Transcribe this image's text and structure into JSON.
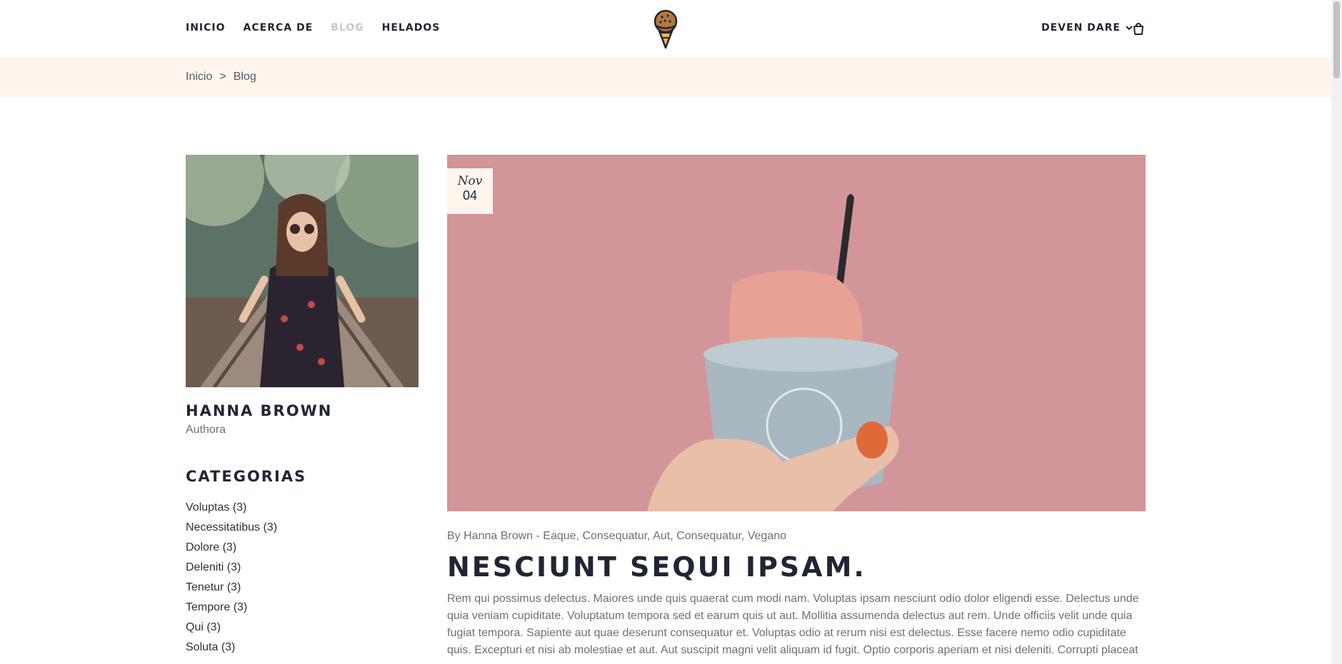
{
  "nav": {
    "items": [
      {
        "label": "INICIO"
      },
      {
        "label": "ACERCA DE"
      },
      {
        "label": "BLOG"
      },
      {
        "label": "HELADOS"
      }
    ]
  },
  "user": {
    "name": "DEVEN DARE"
  },
  "breadcrumb": {
    "home": "Inicio",
    "separator": ">",
    "current": "Blog"
  },
  "author": {
    "name": "HANNA BROWN",
    "role": "Authora"
  },
  "categories": {
    "title": "CATEGORIAS",
    "items": [
      "Voluptas (3)",
      "Necessitatibus (3)",
      "Dolore (3)",
      "Deleniti (3)",
      "Tenetur (3)",
      "Tempore (3)",
      "Qui (3)",
      "Soluta (3)"
    ]
  },
  "post": {
    "date_month": "Nov",
    "date_day": "04",
    "meta": "By Hanna Brown - Eaque, Consequatur, Aut, Consequatur, Vegano",
    "title": "NESCIUNT SEQUI IPSAM.",
    "body": "Rem qui possimus delectus. Maiores unde quis quaerat cum modi nam. Voluptas ipsam nesciunt odio dolor eligendi esse. Delectus unde quia veniam cupiditate. Voluptatum tempora sed et earum quis ut aut. Mollitia assumenda delectus aut rem. Unde officiis velit unde quia fugiat tempora. Sapiente aut quae deserunt consequatur et. Voluptas odio at rerum nisi est delectus. Esse facere nemo odio cupiditate quis. Excepturi et nisi ab molestiae et aut. Aut suscipit magni velit aliquam id fugit. Optio corporis aperiam et nisi deleniti. Corrupti placeat"
  },
  "colors": {
    "accent_bg": "#fff5ed",
    "text_dark": "#1f2633",
    "text_muted": "#6a707b",
    "nav_active": "#c8c8cc",
    "post_image_bg": "#d6999c"
  },
  "icons": {
    "logo": "ice-cream-logo-icon",
    "user_menu": "chevron-down-icon",
    "cart": "shopping-bag-icon"
  }
}
